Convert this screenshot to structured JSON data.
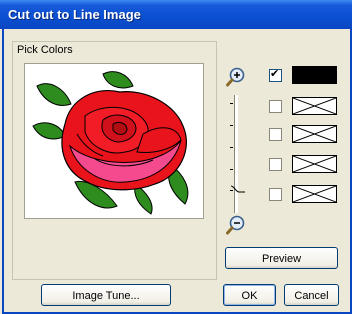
{
  "window": {
    "title": "Cut out to Line Image"
  },
  "group": {
    "label": "Pick Colors"
  },
  "zoom": {
    "in_icon": "zoom-in-icon",
    "out_icon": "zoom-out-icon"
  },
  "colors": [
    {
      "checked": true,
      "color": "#000000",
      "check_mark": "✔"
    },
    {
      "checked": false,
      "color": null
    },
    {
      "checked": false,
      "color": null
    },
    {
      "checked": false,
      "color": null
    },
    {
      "checked": false,
      "color": null
    }
  ],
  "buttons": {
    "preview": "Preview",
    "image_tune": "Image Tune...",
    "ok": "OK",
    "cancel": "Cancel"
  }
}
